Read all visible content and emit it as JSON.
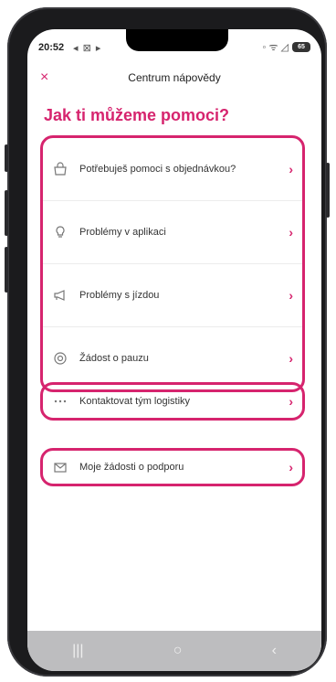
{
  "status": {
    "time": "20:52",
    "left_icons": "◂ ⊠ ▸",
    "right_icons": "◦ ᯤ ◿",
    "battery": "65"
  },
  "header": {
    "close_label": "×",
    "title": "Centrum nápovědy"
  },
  "heading": "Jak ti můžeme pomoci?",
  "sections": {
    "main": [
      {
        "icon": "bag-icon",
        "label": "Potřebuješ pomoci s objednávkou?"
      },
      {
        "icon": "lightbulb-icon",
        "label": "Problémy v aplikaci"
      },
      {
        "icon": "megaphone-icon",
        "label": "Problémy s jízdou"
      },
      {
        "icon": "pause-circle-icon",
        "label": "Žádost o pauzu"
      }
    ],
    "contact": {
      "icon": "more-dots-icon",
      "label": "Kontaktovat tým logistiky"
    },
    "requests": {
      "icon": "envelope-icon",
      "label": "Moje žádosti o podporu"
    }
  },
  "chevron": "›",
  "navbar": {
    "recent": "|||",
    "home": "○",
    "back": "‹"
  },
  "colors": {
    "accent": "#d6246e",
    "highlight_border": "#d6246e"
  }
}
